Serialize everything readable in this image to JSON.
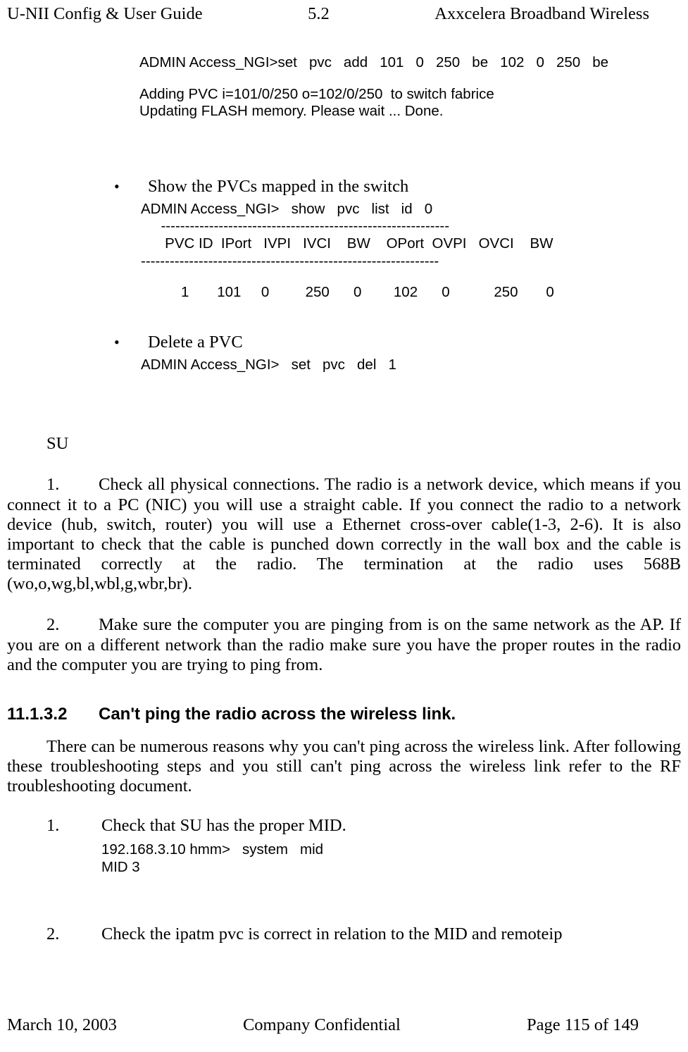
{
  "header": {
    "left": "U-NII Config & User Guide",
    "center": "5.2",
    "right": "Axxcelera Broadband Wireless"
  },
  "top_code": {
    "line1": "ADMIN Access_NGI>set   pvc   add   101   0   250   be   102   0   250   be",
    "line2": "Adding PVC i=101/0/250 o=102/0/250  to switch fabrice",
    "line3": "Updating FLASH memory. Please wait ... Done."
  },
  "bullets": [
    {
      "text": "Show the PVCs mapped in the switch",
      "code": {
        "l1": "ADMIN Access_NGI>   show   pvc   list   id   0",
        "l2": "     ------------------------------------------------------------",
        "l3": "      PVC ID  IPort   IVPI   IVCI    BW    OPort  OVPI   OVCI    BW",
        "l4": "--------------------------------------------------------------",
        "l5": "          1       101     0         250      0        102      0           250       0"
      }
    },
    {
      "text": "Delete a PVC",
      "code": {
        "l1": "ADMIN Access_NGI>   set   pvc   del   1"
      }
    }
  ],
  "su_label": "SU",
  "numbered_body": [
    {
      "num": "1.",
      "text": "Check all physical connections. The radio is a network device, which means if you connect it to a PC (NIC) you will use a straight cable. If you connect the radio to a network device (hub, switch, router) you will use a Ethernet cross-over cable(1-3, 2-6). It is also important to check that the cable is punched down correctly in the wall box and the cable is terminated correctly at the radio.  The termination at the radio uses 568B (wo,o,wg,bl,wbl,g,wbr,br)."
    },
    {
      "num": "2.",
      "text": "Make sure the computer you are pinging from is on the same network as the AP. If you are on a different network than the radio make sure you have the proper routes in the radio and the computer you are trying to ping from."
    }
  ],
  "section": {
    "num": "11.1.3.2",
    "title": "Can't ping the radio across the wireless link."
  },
  "section_para": "There can be numerous reasons why you can't ping across the wireless link. After following these troubleshooting steps and you still can't ping across the wireless link refer to the RF troubleshooting document.",
  "section_list": [
    {
      "num": "1.",
      "text": "Check that SU has the proper MID.",
      "code": {
        "l1": "192.168.3.10 hmm>   system   mid",
        "l2": "MID 3"
      }
    },
    {
      "num": "2.",
      "text": "Check the ipatm pvc is correct in relation to the MID and remoteip"
    }
  ],
  "footer": {
    "left": "March 10, 2003",
    "center": "Company Confidential",
    "right": "Page 115 of 149"
  }
}
